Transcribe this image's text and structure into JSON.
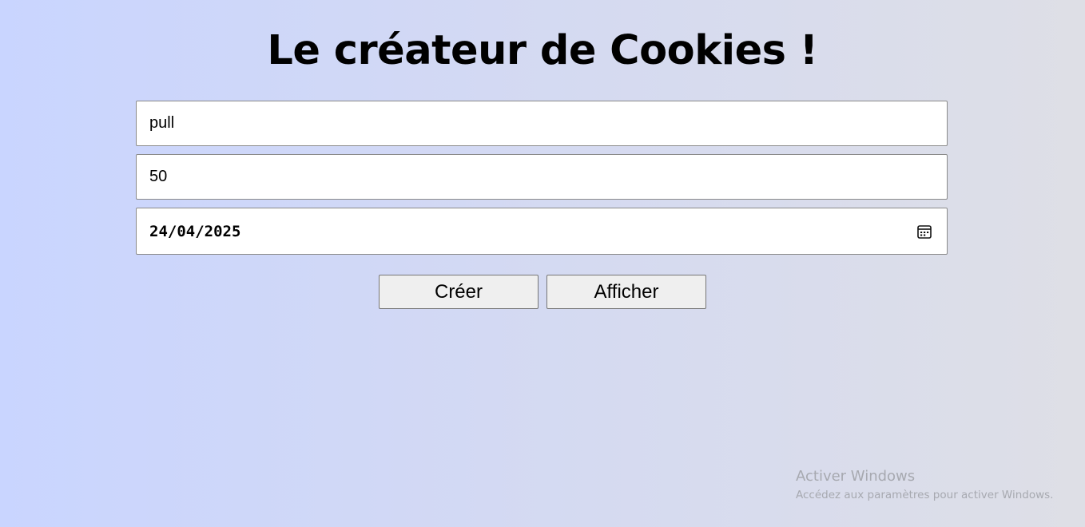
{
  "page": {
    "title": "Le créateur de Cookies !"
  },
  "form": {
    "name_value": "pull",
    "quantity_value": "50",
    "date_value": "24/04/2025",
    "calendar_icon": "calendar-icon"
  },
  "buttons": {
    "create_label": "Créer",
    "show_label": "Afficher"
  },
  "watermark": {
    "title": "Activer Windows",
    "subtitle": "Accédez aux paramètres pour activer Windows."
  },
  "colors": {
    "background_start": "#c9d5ff",
    "background_end": "#dedfe6",
    "button_bg": "#efefef"
  }
}
